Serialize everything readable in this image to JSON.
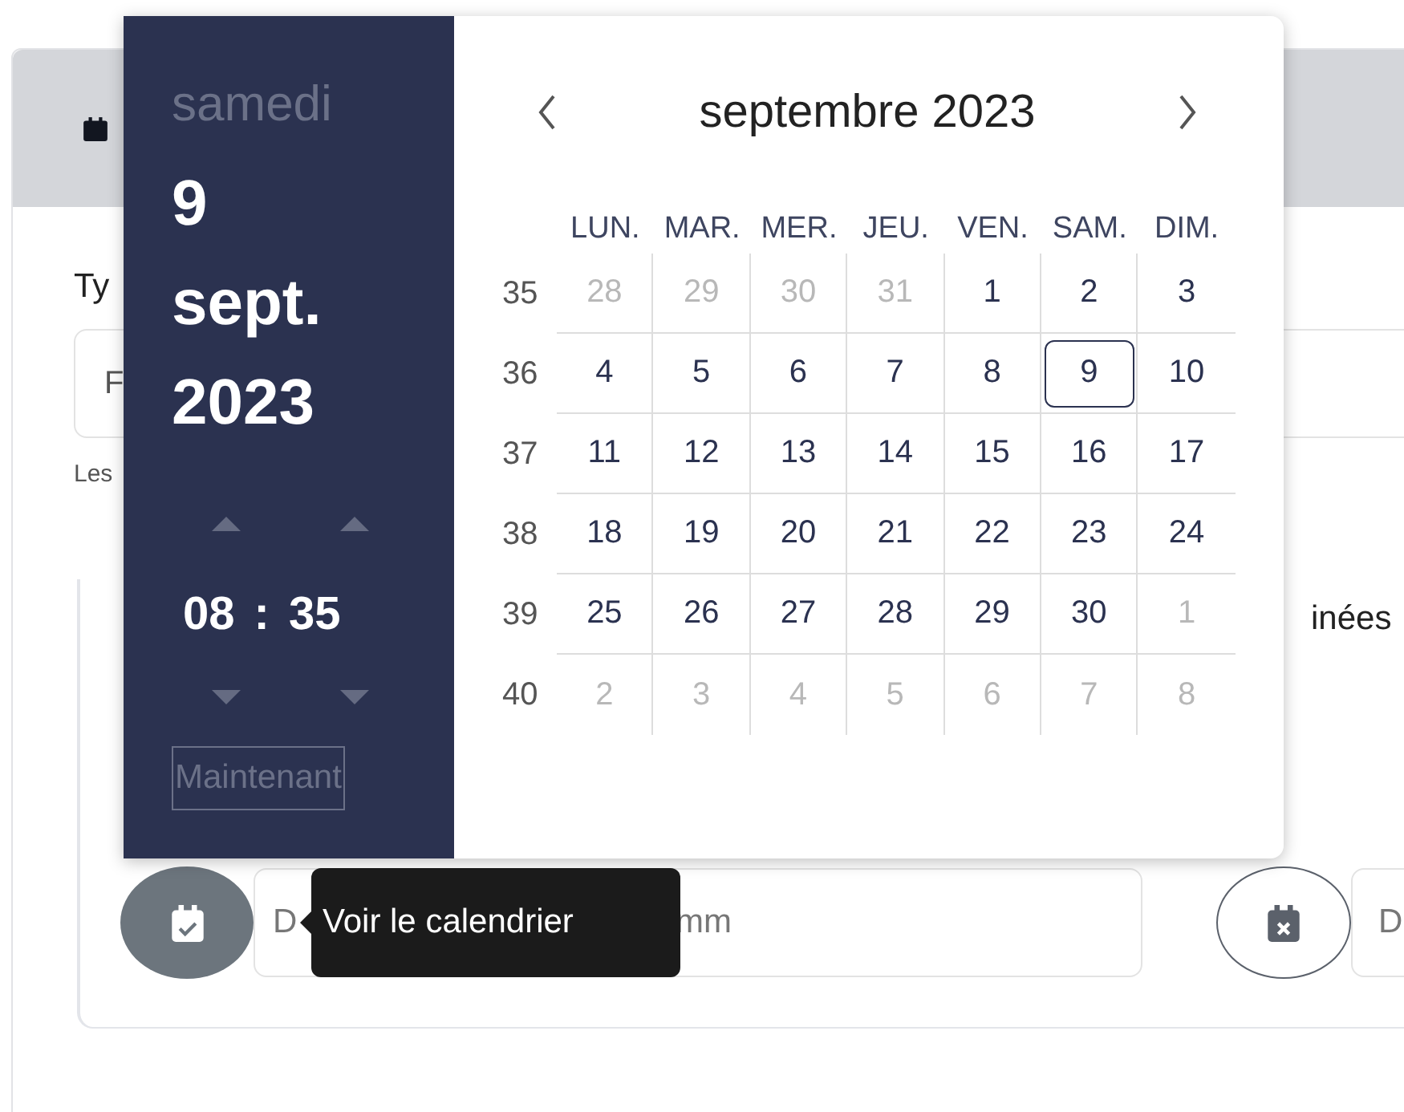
{
  "background": {
    "label": "Ty",
    "field_value": "F",
    "helper": "Les",
    "section_title": "inées",
    "date_field": {
      "placeholder_start": "D",
      "placeholder_end": "mm"
    },
    "second_field": {
      "placeholder": "D"
    }
  },
  "tooltip": "Voir le calendrier",
  "picker": {
    "weekday": "samedi",
    "day": "9",
    "month": "sept.",
    "year": "2023",
    "hours": "08",
    "separator": ":",
    "minutes": "35",
    "now_button": "Maintenant",
    "month_title": "septembre 2023",
    "weekdays": [
      "LUN.",
      "MAR.",
      "MER.",
      "JEU.",
      "VEN.",
      "SAM.",
      "DIM."
    ],
    "weeks": [
      {
        "number": "35",
        "days": [
          {
            "label": "28",
            "outside": true,
            "selected": false
          },
          {
            "label": "29",
            "outside": true,
            "selected": false
          },
          {
            "label": "30",
            "outside": true,
            "selected": false
          },
          {
            "label": "31",
            "outside": true,
            "selected": false
          },
          {
            "label": "1",
            "outside": false,
            "selected": false
          },
          {
            "label": "2",
            "outside": false,
            "selected": false
          },
          {
            "label": "3",
            "outside": false,
            "selected": false
          }
        ]
      },
      {
        "number": "36",
        "days": [
          {
            "label": "4",
            "outside": false,
            "selected": false
          },
          {
            "label": "5",
            "outside": false,
            "selected": false
          },
          {
            "label": "6",
            "outside": false,
            "selected": false
          },
          {
            "label": "7",
            "outside": false,
            "selected": false
          },
          {
            "label": "8",
            "outside": false,
            "selected": false
          },
          {
            "label": "9",
            "outside": false,
            "selected": true
          },
          {
            "label": "10",
            "outside": false,
            "selected": false
          }
        ]
      },
      {
        "number": "37",
        "days": [
          {
            "label": "11",
            "outside": false,
            "selected": false
          },
          {
            "label": "12",
            "outside": false,
            "selected": false
          },
          {
            "label": "13",
            "outside": false,
            "selected": false
          },
          {
            "label": "14",
            "outside": false,
            "selected": false
          },
          {
            "label": "15",
            "outside": false,
            "selected": false
          },
          {
            "label": "16",
            "outside": false,
            "selected": false
          },
          {
            "label": "17",
            "outside": false,
            "selected": false
          }
        ]
      },
      {
        "number": "38",
        "days": [
          {
            "label": "18",
            "outside": false,
            "selected": false
          },
          {
            "label": "19",
            "outside": false,
            "selected": false
          },
          {
            "label": "20",
            "outside": false,
            "selected": false
          },
          {
            "label": "21",
            "outside": false,
            "selected": false
          },
          {
            "label": "22",
            "outside": false,
            "selected": false
          },
          {
            "label": "23",
            "outside": false,
            "selected": false
          },
          {
            "label": "24",
            "outside": false,
            "selected": false
          }
        ]
      },
      {
        "number": "39",
        "days": [
          {
            "label": "25",
            "outside": false,
            "selected": false
          },
          {
            "label": "26",
            "outside": false,
            "selected": false
          },
          {
            "label": "27",
            "outside": false,
            "selected": false
          },
          {
            "label": "28",
            "outside": false,
            "selected": false
          },
          {
            "label": "29",
            "outside": false,
            "selected": false
          },
          {
            "label": "30",
            "outside": false,
            "selected": false
          },
          {
            "label": "1",
            "outside": true,
            "selected": false
          }
        ]
      },
      {
        "number": "40",
        "days": [
          {
            "label": "2",
            "outside": true,
            "selected": false
          },
          {
            "label": "3",
            "outside": true,
            "selected": false
          },
          {
            "label": "4",
            "outside": true,
            "selected": false
          },
          {
            "label": "5",
            "outside": true,
            "selected": false
          },
          {
            "label": "6",
            "outside": true,
            "selected": false
          },
          {
            "label": "7",
            "outside": true,
            "selected": false
          },
          {
            "label": "8",
            "outside": true,
            "selected": false
          }
        ]
      }
    ]
  }
}
